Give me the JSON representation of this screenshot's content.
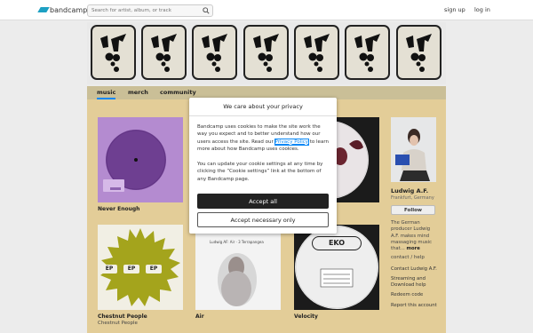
{
  "header": {
    "logo_text": "bandcamp",
    "search_placeholder": "Search for artist, album, or track",
    "signup_label": "sign up",
    "login_label": "log in"
  },
  "nav": {
    "tabs": [
      {
        "label": "music"
      },
      {
        "label": "merch"
      },
      {
        "label": "community"
      }
    ]
  },
  "releases": [
    {
      "title": "Never Enough",
      "artist": ""
    },
    {
      "title": "Chestnut People",
      "artist": "Chestnut People"
    },
    {
      "title": "Air",
      "artist": ""
    },
    {
      "title": "Velocity",
      "artist": ""
    }
  ],
  "art_text": {
    "air_caption": "Ludwig AF: Air · 3 Terrapangea",
    "velocity_logo": "EKO",
    "chestnut_badges": [
      "EP",
      "EP",
      "EP"
    ]
  },
  "artist": {
    "name": "Ludwig A.F.",
    "location": "Frankfurt, Germany",
    "follow_label": "Follow",
    "bio": "The German producer Ludwig A.F. makes mind massaging music that...",
    "more_label": "more",
    "contact_label": "contact / help",
    "links": [
      "Contact Ludwig A.F.",
      "Streaming and Download help",
      "Redeem code",
      "Report this account"
    ]
  },
  "cookie_modal": {
    "title": "We care about your privacy",
    "p1_before": "Bandcamp uses cookies to make the site work the way you expect and to better understand how our users access the site. Read our ",
    "p1_link": "Privacy Policy",
    "p1_after": " to learn more about how Bandcamp uses cookies.",
    "p2": "You can update your cookie settings at any time by clicking the “Cookie settings” link at the bottom of any Bandcamp page.",
    "accept_all": "Accept all",
    "accept_necessary": "Accept necessary only"
  },
  "colors": {
    "accent": "#0687f5",
    "logo": "#1da0c3",
    "nav_bg": "#cabf97",
    "main_bg": "#e3cd98"
  }
}
